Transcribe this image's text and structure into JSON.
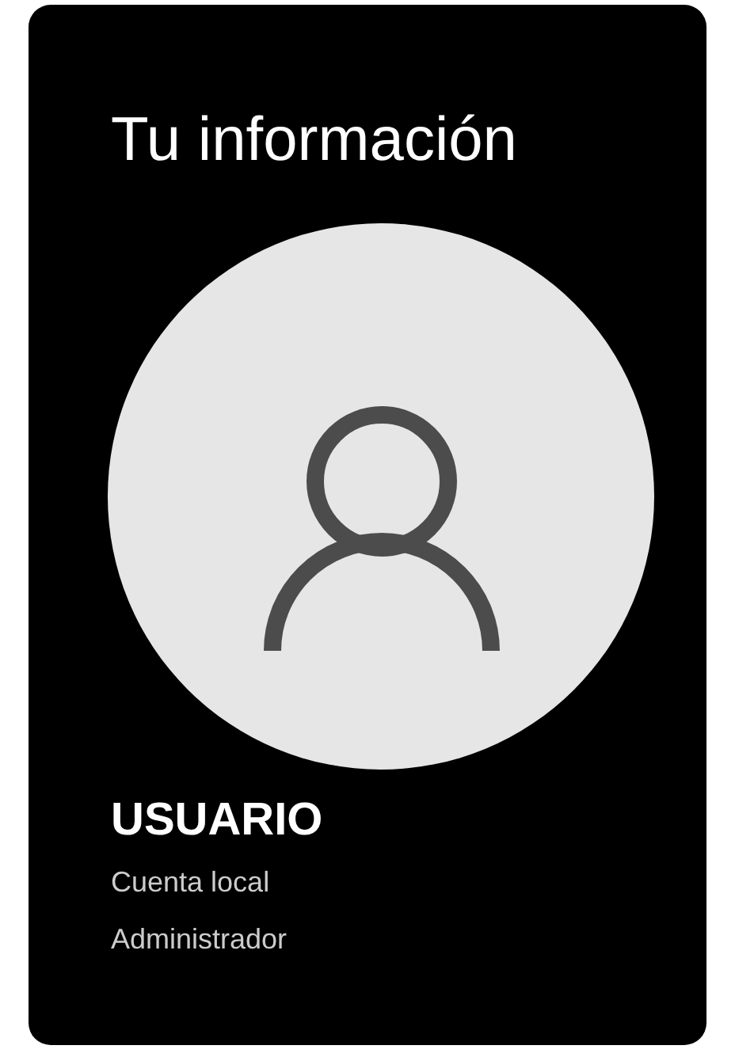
{
  "title": "Tu información",
  "account": {
    "name": "USUARIO",
    "type": "Cuenta local",
    "role": "Administrador"
  }
}
